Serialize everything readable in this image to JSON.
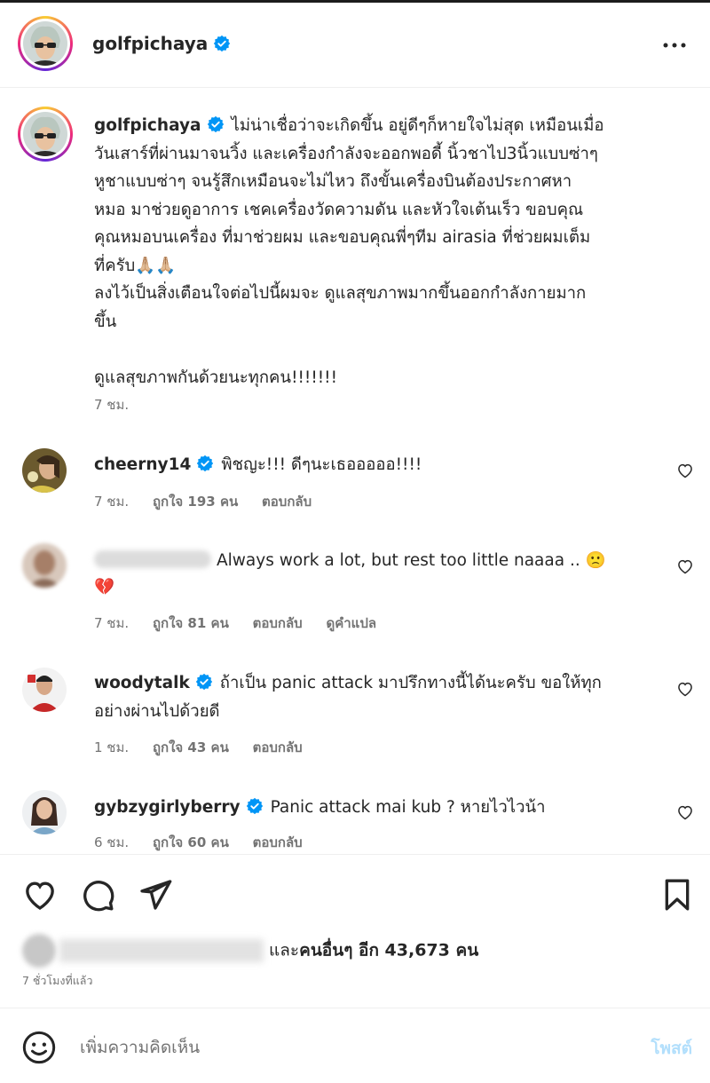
{
  "header": {
    "username": "golfpichaya",
    "more_icon": "more-horizontal-icon"
  },
  "caption": {
    "username": "golfpichaya",
    "lines": [
      "ไม่น่าเชื่อว่าจะเกิดขึ้น อยู่ดีๆก็หายใจไม่สุด เหมือนเมื่อ",
      "วันเสาร์ที่ผ่านมาจนวิ้ง และเครื่องกำลังจะออกพอดี้ นิ้วชาไป3นิ้วแบบซ่าๆ",
      "หูชาแบบซ่าๆ จนรู้สึกเหมือนจะไม่ไหว ถึงขั้นเครื่องบินต้องประกาศหา",
      "หมอ มาช่วยดูอาการ เชคเครื่องวัดความดัน และหัวใจเต้นเร็ว ขอบคุณ",
      "คุณหมอบนเครื่อง ที่มาช่วยผม และขอบคุณพี่ๆทีม airasia ที่ช่วยผมเต็ม",
      "ที่ครับ🙏🏼🙏🏼",
      "ลงไว้เป็นสิ่งเตือนใจต่อไปนี้ผมจะ ดูแลสุขภาพมากขึ้นออกกำลังกายมาก",
      "ขึ้น",
      "",
      "ดูแลสุขภาพกันด้วยนะทุกคน!!!!!!!"
    ],
    "time": "7 ชม."
  },
  "comments": [
    {
      "username": "cheerny14",
      "text": "พิชญะ!!! ดีๆนะเธอออออ!!!!",
      "time": "7 ชม.",
      "likes": "ถูกใจ 193 คน",
      "reply": "ตอบกลับ"
    },
    {
      "username": "",
      "text": "Always work a lot, but rest too little naaaa .. 🙁",
      "text2": "💔",
      "time": "7 ชม.",
      "likes": "ถูกใจ 81 คน",
      "reply": "ตอบกลับ",
      "translate": "ดูคำแปล"
    },
    {
      "username": "woodytalk",
      "text": "ถ้าเป็น panic attack มาปรึกทางนี้ได้นะครับ ขอให้ทุก",
      "text2": "อย่างผ่านไปด้วยดี",
      "time": "1 ชม.",
      "likes": "ถูกใจ 43 คน",
      "reply": "ตอบกลับ"
    },
    {
      "username": "gybzygirlyberry",
      "text": "Panic attack mai kub ? หายไวไวน้า",
      "time": "6 ชม.",
      "likes": "ถูกใจ 60 คน",
      "reply": "ตอบกลับ"
    }
  ],
  "likes_summary": {
    "and_others": "และ",
    "others_bold": "คนอื่นๆ อีก 43,673 คน"
  },
  "post_time": "7 ชั่วโมงที่แล้ว",
  "comment_box": {
    "placeholder": "เพิ่มความคิดเห็น",
    "post_label": "โพสต์"
  },
  "colors": {
    "verified": "#0095f6",
    "muted": "#737373",
    "post_disabled": "#b2dffc"
  }
}
